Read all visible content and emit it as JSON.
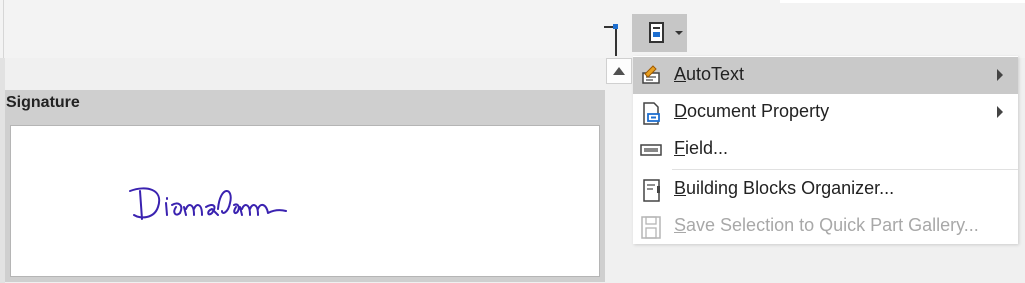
{
  "panel": {
    "title": "Signature"
  },
  "menu": {
    "items": [
      {
        "key": "A",
        "rest": "utoText",
        "submenu": true,
        "highlighted": true,
        "icon": "autotext-icon"
      },
      {
        "key": "D",
        "rest": "ocument Property",
        "submenu": true,
        "icon": "document-property-icon"
      },
      {
        "key": "F",
        "rest": "ield...",
        "submenu": false,
        "icon": "field-icon"
      },
      {
        "key": "B",
        "rest": "uilding Blocks Organizer...",
        "submenu": false,
        "icon": "building-blocks-icon"
      },
      {
        "key": "S",
        "rest": "ave Selection to Quick Part Gallery...",
        "submenu": false,
        "disabled": true,
        "icon": "save-icon"
      }
    ]
  },
  "toolbar": {
    "quick_parts_icon": "quick-parts-icon"
  },
  "colors": {
    "accent": "#1e6fd0",
    "highlight": "#c9c9c9",
    "signature_ink": "#3a22b0"
  }
}
